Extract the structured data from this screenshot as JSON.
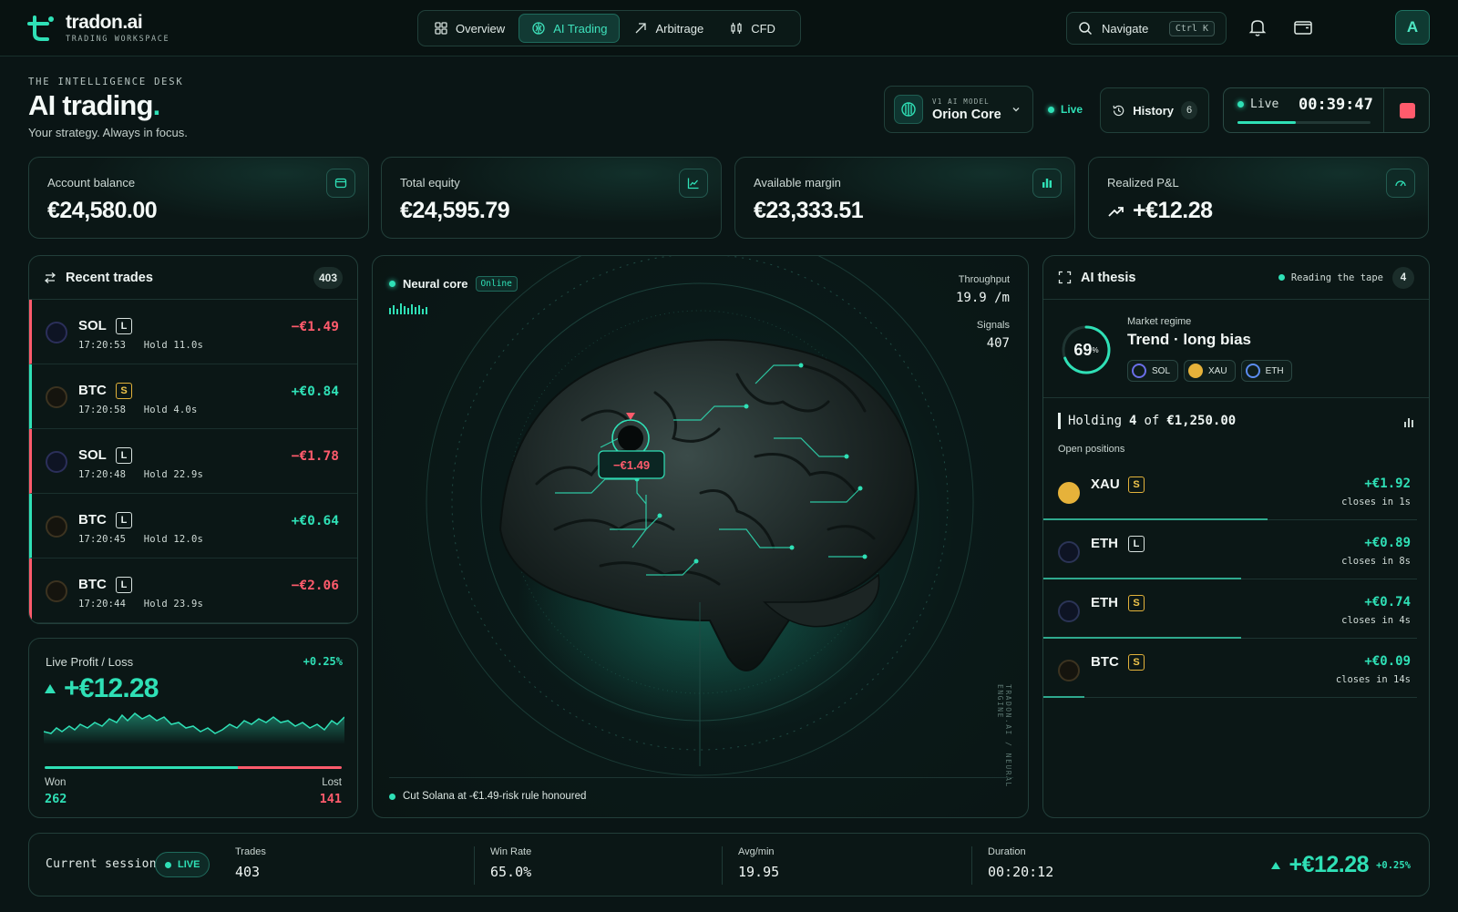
{
  "app": {
    "name": "tradon.ai",
    "subtitle": "TRADING WORKSPACE"
  },
  "nav": {
    "items": [
      {
        "label": "Overview",
        "icon": "grid-icon",
        "active": false
      },
      {
        "label": "AI Trading",
        "icon": "ai-chip-icon",
        "active": true
      },
      {
        "label": "Arbitrage",
        "icon": "arrow-up-right-icon",
        "active": false
      },
      {
        "label": "CFD",
        "icon": "candles-icon",
        "active": false
      }
    ]
  },
  "search": {
    "label": "Navigate",
    "shortcut": "Ctrl K"
  },
  "user": {
    "initial": "A"
  },
  "header": {
    "eyebrow": "THE INTELLIGENCE DESK",
    "title": "AI trading",
    "title_dot": ".",
    "subtitle": "Your strategy. Always in focus."
  },
  "model": {
    "eyebrow": "V1 AI MODEL",
    "name": "Orion Core"
  },
  "status": {
    "live": "Live"
  },
  "history": {
    "label": "History",
    "count": "6"
  },
  "timer": {
    "label": "Live",
    "time": "00:39:47",
    "progress": 0.44
  },
  "stats": [
    {
      "label": "Account balance",
      "value": "€24,580.00",
      "icon": "wallet-icon"
    },
    {
      "label": "Total equity",
      "value": "€24,595.79",
      "icon": "line-chart-icon"
    },
    {
      "label": "Available margin",
      "value": "€23,333.51",
      "icon": "bar-chart-icon"
    },
    {
      "label": "Realized P&L",
      "value": "+€12.28",
      "icon": "gauge-icon"
    }
  ],
  "recent_trades": {
    "title": "Recent trades",
    "count": "403",
    "items": [
      {
        "symbol": "SOL",
        "side": "L",
        "time": "17:20:53",
        "hold": "Hold 11.0s",
        "pnl": "−€1.49",
        "win": false
      },
      {
        "symbol": "BTC",
        "side": "S",
        "time": "17:20:58",
        "hold": "Hold 4.0s",
        "pnl": "+€0.84",
        "win": true
      },
      {
        "symbol": "SOL",
        "side": "L",
        "time": "17:20:48",
        "hold": "Hold 22.9s",
        "pnl": "−€1.78",
        "win": false
      },
      {
        "symbol": "BTC",
        "side": "L",
        "time": "17:20:45",
        "hold": "Hold 12.0s",
        "pnl": "+€0.64",
        "win": true
      },
      {
        "symbol": "BTC",
        "side": "L",
        "time": "17:20:44",
        "hold": "Hold 23.9s",
        "pnl": "−€2.06",
        "win": false
      }
    ]
  },
  "live_pnl": {
    "label": "Live Profit / Loss",
    "pct": "+0.25%",
    "value": "+€12.28",
    "won_label": "Won",
    "won": "262",
    "lost_label": "Lost",
    "lost": "141",
    "won_fraction": 0.65
  },
  "neural": {
    "title": "Neural core",
    "status": "Online",
    "throughput_label": "Throughput",
    "throughput": "19.9 /m",
    "signals_label": "Signals",
    "signals": "407",
    "marker": "−€1.49",
    "footer": "Cut Solana at -€1.49-risk rule honoured",
    "vertical_text": "TRADON.AI / NEURAL ENGINE"
  },
  "thesis": {
    "title": "AI thesis",
    "status": "Reading the tape",
    "count": "4",
    "confidence": "69",
    "confidence_unit": "%",
    "confidence_fraction": 0.69,
    "regime_label": "Market regime",
    "regime": "Trend · long bias",
    "chips": [
      {
        "label": "SOL",
        "color": "#6a6ee8"
      },
      {
        "label": "XAU",
        "color": "#e6b23a"
      },
      {
        "label": "ETH",
        "color": "#5b8cf0"
      }
    ],
    "holding_prefix": "Holding",
    "holding_count": "4",
    "holding_of": "of",
    "holding_amount": "€1,250.00",
    "open_label": "Open positions",
    "positions": [
      {
        "symbol": "XAU",
        "side": "S",
        "pnl": "+€1.92",
        "closes": "closes in 1s",
        "progress": 0.6
      },
      {
        "symbol": "ETH",
        "side": "L",
        "pnl": "+€0.89",
        "closes": "closes in 8s",
        "progress": 0.53
      },
      {
        "symbol": "ETH",
        "side": "S",
        "pnl": "+€0.74",
        "closes": "closes in 4s",
        "progress": 0.53
      },
      {
        "symbol": "BTC",
        "side": "S",
        "pnl": "+€0.09",
        "closes": "closes in 14s",
        "progress": 0.11
      }
    ]
  },
  "session": {
    "label": "Current session",
    "live": "LIVE",
    "metrics": [
      {
        "label": "Trades",
        "value": "403"
      },
      {
        "label": "Win Rate",
        "value": "65.0%"
      },
      {
        "label": "Avg/min",
        "value": "19.95"
      },
      {
        "label": "Duration",
        "value": "00:20:12"
      }
    ],
    "total": "+€12.28",
    "pct": "+0.25%"
  },
  "colors": {
    "accent": "#2fe0b6",
    "loss": "#ff5b6c",
    "short": "#e2b23a",
    "bg": "#0a1515"
  }
}
